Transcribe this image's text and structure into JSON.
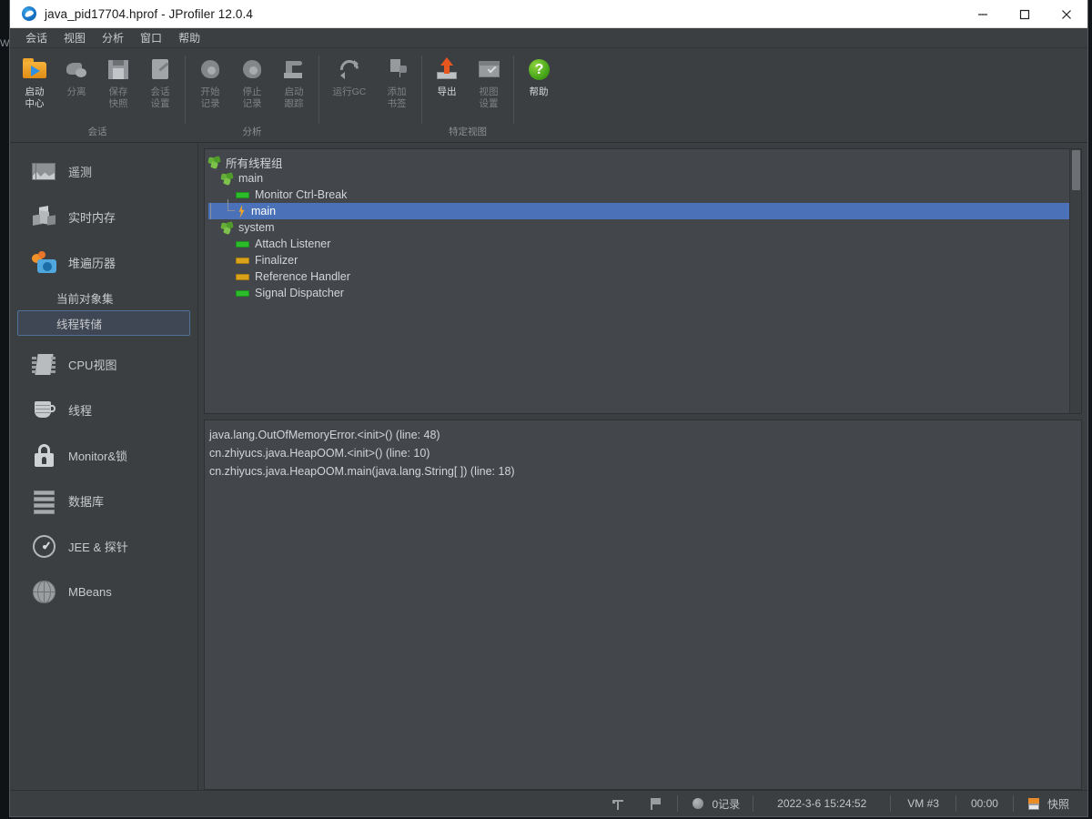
{
  "window": {
    "title": "java_pid17704.hprof - JProfiler 12.0.4",
    "app_icon": "jprofiler-logo-icon",
    "controls": {
      "minimize": "minimize-icon",
      "maximize": "maximize-icon",
      "close": "close-icon"
    }
  },
  "desktop": {
    "left_text": "W"
  },
  "menubar": {
    "items": [
      {
        "label": "会话"
      },
      {
        "label": "视图"
      },
      {
        "label": "分析"
      },
      {
        "label": "窗口"
      },
      {
        "label": "帮助"
      }
    ]
  },
  "toolbar": {
    "groups": [
      {
        "caption": "会话",
        "buttons": [
          {
            "label": "启动\n中心",
            "icon": "start-center-icon",
            "enabled": true
          },
          {
            "label": "分离",
            "icon": "detach-icon",
            "enabled": false
          },
          {
            "label": "保存\n快照",
            "icon": "save-snapshot-icon",
            "enabled": false
          },
          {
            "label": "会话\n设置",
            "icon": "session-settings-icon",
            "enabled": false
          }
        ]
      },
      {
        "caption": "分析",
        "buttons": [
          {
            "label": "开始\n记录",
            "icon": "start-recording-icon",
            "enabled": false
          },
          {
            "label": "停止\n记录",
            "icon": "stop-recording-icon",
            "enabled": false
          },
          {
            "label": "启动\n跟踪",
            "icon": "start-tracking-icon",
            "enabled": false
          },
          {
            "label": "运行GC",
            "icon": "run-gc-icon",
            "enabled": false
          },
          {
            "label": "添加\n书签",
            "icon": "add-bookmark-icon",
            "enabled": false
          }
        ]
      },
      {
        "caption": "特定视图",
        "buttons": [
          {
            "label": "导出",
            "icon": "export-icon",
            "enabled": true
          },
          {
            "label": "视图\n设置",
            "icon": "view-settings-icon",
            "enabled": false
          }
        ]
      },
      {
        "caption": "",
        "buttons": [
          {
            "label": "帮助",
            "icon": "help-icon",
            "enabled": true
          }
        ]
      }
    ]
  },
  "sidebar": {
    "items": [
      {
        "label": "遥测",
        "icon": "telemetry-icon",
        "type": "item"
      },
      {
        "label": "实时内存",
        "icon": "live-memory-icon",
        "type": "item"
      },
      {
        "label": "堆遍历器",
        "icon": "heap-walker-icon",
        "type": "item"
      },
      {
        "label": "当前对象集",
        "type": "sub",
        "selected": false
      },
      {
        "label": "线程转储",
        "type": "sub",
        "selected": true
      },
      {
        "label": "CPU视图",
        "icon": "cpu-views-icon",
        "type": "item"
      },
      {
        "label": "线程",
        "icon": "threads-icon",
        "type": "item"
      },
      {
        "label": "Monitor&锁",
        "icon": "monitors-locks-icon",
        "type": "item"
      },
      {
        "label": "数据库",
        "icon": "databases-icon",
        "type": "item"
      },
      {
        "label": "JEE & 探针",
        "icon": "jee-probes-icon",
        "type": "item"
      },
      {
        "label": "MBeans",
        "icon": "mbeans-icon",
        "type": "item"
      }
    ]
  },
  "thread_tree": {
    "rows": [
      {
        "label": "所有线程组",
        "icon": "thread-group-icon",
        "indent": 0,
        "selected": false
      },
      {
        "label": "main",
        "icon": "thread-group-icon",
        "indent": 1,
        "selected": false
      },
      {
        "label": "Monitor Ctrl-Break",
        "icon": "thread-green-bar-icon",
        "indent": 2,
        "selected": false
      },
      {
        "label": "main",
        "icon": "thread-running-bolt-icon",
        "indent": 2,
        "selected": true
      },
      {
        "label": "system",
        "icon": "thread-group-icon",
        "indent": 1,
        "selected": false
      },
      {
        "label": "Attach Listener",
        "icon": "thread-green-bar-icon",
        "indent": 2,
        "selected": false
      },
      {
        "label": "Finalizer",
        "icon": "thread-orange-bar-icon",
        "indent": 2,
        "selected": false
      },
      {
        "label": "Reference Handler",
        "icon": "thread-orange-bar-icon",
        "indent": 2,
        "selected": false
      },
      {
        "label": "Signal Dispatcher",
        "icon": "thread-green-bar-icon",
        "indent": 2,
        "selected": false
      }
    ]
  },
  "stack_trace": {
    "lines": [
      "java.lang.OutOfMemoryError.<init>() (line: 48)",
      "cn.zhiyucs.java.HeapOOM.<init>() (line: 10)",
      "cn.zhiyucs.java.HeapOOM.main(java.lang.String[ ]) (line: 18)"
    ]
  },
  "statusbar": {
    "pin_icon": "pin-icon",
    "flag_icon": "flag-icon",
    "recording_icon": "recording-status-icon",
    "recording_label": "0记录",
    "timestamp": "2022-3-6 15:24:52",
    "vm_label": "VM #3",
    "elapsed": "00:00",
    "snapshot_icon": "snapshot-icon",
    "snapshot_label": "快照"
  },
  "colors": {
    "window_bg": "#3c3f41",
    "panel_bg": "#43464a",
    "selection_blue": "#4b72b8",
    "sidebar_selected_border": "#4f7396",
    "accent_orange": "#e8561f",
    "thread_green": "#2bbb2b",
    "thread_orange": "#d9a21a",
    "help_green": "#49a81a"
  }
}
